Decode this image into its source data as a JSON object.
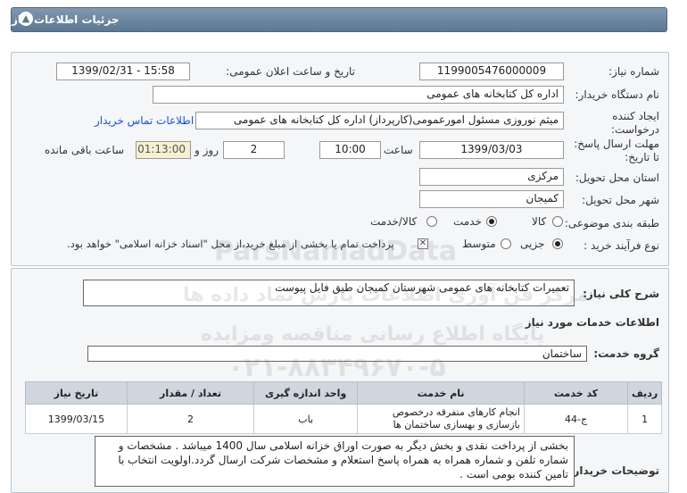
{
  "header": {
    "title": "جزئیات اطلاعات نیاز"
  },
  "fields": {
    "need_number_label": "شماره نیاز:",
    "need_number": "1199005476000009",
    "announce_label": "تاریخ و ساعت اعلان عمومی:",
    "announce_value": "1399/02/31 - 15:58",
    "buyer_org_label": "نام دستگاه خریدار:",
    "buyer_org": "اداره کل کتابخانه های عمومی",
    "creator_label": "ایجاد کننده درخواست:",
    "creator": "میثم نوروزی مسئول امورعمومی(کارپرداز) اداره کل کتابخانه های عمومی",
    "contact_link": "اطلاعات تماس خریدار",
    "deadline_label": "مهلت ارسال پاسخ: تا تاریخ:",
    "deadline_date": "1399/03/03",
    "time_label": "ساعت",
    "deadline_time": "10:00",
    "days_and_label": "روز و",
    "days_value": "2",
    "remaining_time": "01:13:00",
    "remaining_label": "ساعت باقی مانده",
    "province_label": "استان محل تحویل:",
    "province": "مرکزی",
    "city_label": "شهر محل تحویل:",
    "city": "کمیجان",
    "category_label": "طبقه بندی موضوعی:",
    "category_options": [
      "کالا",
      "خدمت",
      "کالا/خدمت"
    ],
    "purchase_type_label": "نوع فرآیند خرید :",
    "purchase_type_options": [
      "جزیی",
      "متوسط"
    ],
    "payment_note": "پرداخت تمام یا بخشی از مبلغ خرید،از محل \"اسناد خزانه اسلامی\" خواهد بود."
  },
  "summary": {
    "label": "شرح کلی نیاز:",
    "value": "تعمیرات کتابخانه های عمومی شهرستان کمیجان طبق فایل پیوست"
  },
  "services": {
    "title": "اطلاعات خدمات مورد نیاز",
    "group_label": "گروه خدمت:",
    "group_value": "ساختمان",
    "columns": [
      "ردیف",
      "کد خدمت",
      "نام خدمت",
      "واحد اندازه گیری",
      "تعداد / مقدار",
      "تاریخ نیاز"
    ],
    "rows": [
      [
        "1",
        "ج-44",
        "انجام کارهای متفرقه درخصوص بازسازی و بهسازی ساختمان ها",
        "باب",
        "2",
        "1399/03/15"
      ]
    ]
  },
  "buyer_notes": {
    "label": "توضیحات خریدار:",
    "value": "بخشی از پرداخت نقدی و بخش دیگر به صورت اوراق خزانه اسلامی سال 1400 میباشد . مشخصات و شماره تلفن و شماره همراه  به همراه پاسخ استعلام  و مشخصات شرکت ارسال گردد.اولویت انتخاب با تامین کننده بومی است ."
  },
  "watermark": {
    "line1": "ParsNamadData",
    "line2": "مرکز فن آوری اطلاعات پارس نماد داده ها",
    "line3": "پایگاه اطلاع رسانی مناقصه ومزایده",
    "line4": "۰۲۱-۸۸۳۴۹۶۷۰-۵"
  }
}
